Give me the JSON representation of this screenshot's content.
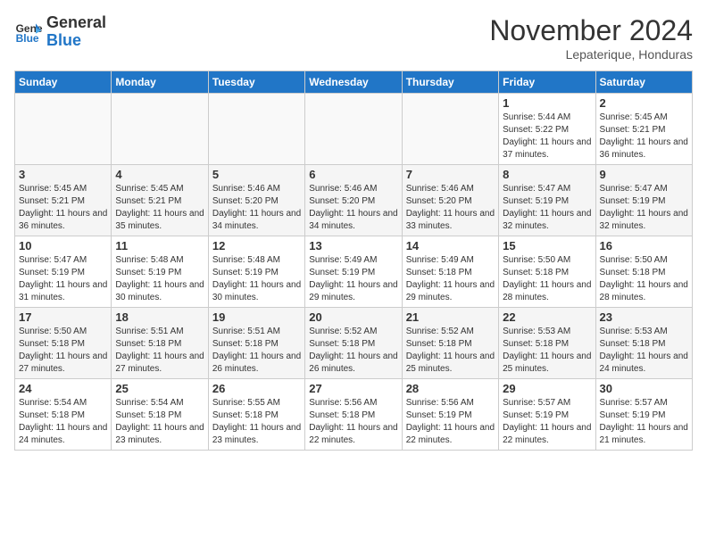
{
  "header": {
    "logo_line1": "General",
    "logo_line2": "Blue",
    "month": "November 2024",
    "location": "Lepaterique, Honduras"
  },
  "weekdays": [
    "Sunday",
    "Monday",
    "Tuesday",
    "Wednesday",
    "Thursday",
    "Friday",
    "Saturday"
  ],
  "weeks": [
    [
      {
        "day": "",
        "info": ""
      },
      {
        "day": "",
        "info": ""
      },
      {
        "day": "",
        "info": ""
      },
      {
        "day": "",
        "info": ""
      },
      {
        "day": "",
        "info": ""
      },
      {
        "day": "1",
        "info": "Sunrise: 5:44 AM\nSunset: 5:22 PM\nDaylight: 11 hours and 37 minutes."
      },
      {
        "day": "2",
        "info": "Sunrise: 5:45 AM\nSunset: 5:21 PM\nDaylight: 11 hours and 36 minutes."
      }
    ],
    [
      {
        "day": "3",
        "info": "Sunrise: 5:45 AM\nSunset: 5:21 PM\nDaylight: 11 hours and 36 minutes."
      },
      {
        "day": "4",
        "info": "Sunrise: 5:45 AM\nSunset: 5:21 PM\nDaylight: 11 hours and 35 minutes."
      },
      {
        "day": "5",
        "info": "Sunrise: 5:46 AM\nSunset: 5:20 PM\nDaylight: 11 hours and 34 minutes."
      },
      {
        "day": "6",
        "info": "Sunrise: 5:46 AM\nSunset: 5:20 PM\nDaylight: 11 hours and 34 minutes."
      },
      {
        "day": "7",
        "info": "Sunrise: 5:46 AM\nSunset: 5:20 PM\nDaylight: 11 hours and 33 minutes."
      },
      {
        "day": "8",
        "info": "Sunrise: 5:47 AM\nSunset: 5:19 PM\nDaylight: 11 hours and 32 minutes."
      },
      {
        "day": "9",
        "info": "Sunrise: 5:47 AM\nSunset: 5:19 PM\nDaylight: 11 hours and 32 minutes."
      }
    ],
    [
      {
        "day": "10",
        "info": "Sunrise: 5:47 AM\nSunset: 5:19 PM\nDaylight: 11 hours and 31 minutes."
      },
      {
        "day": "11",
        "info": "Sunrise: 5:48 AM\nSunset: 5:19 PM\nDaylight: 11 hours and 30 minutes."
      },
      {
        "day": "12",
        "info": "Sunrise: 5:48 AM\nSunset: 5:19 PM\nDaylight: 11 hours and 30 minutes."
      },
      {
        "day": "13",
        "info": "Sunrise: 5:49 AM\nSunset: 5:19 PM\nDaylight: 11 hours and 29 minutes."
      },
      {
        "day": "14",
        "info": "Sunrise: 5:49 AM\nSunset: 5:18 PM\nDaylight: 11 hours and 29 minutes."
      },
      {
        "day": "15",
        "info": "Sunrise: 5:50 AM\nSunset: 5:18 PM\nDaylight: 11 hours and 28 minutes."
      },
      {
        "day": "16",
        "info": "Sunrise: 5:50 AM\nSunset: 5:18 PM\nDaylight: 11 hours and 28 minutes."
      }
    ],
    [
      {
        "day": "17",
        "info": "Sunrise: 5:50 AM\nSunset: 5:18 PM\nDaylight: 11 hours and 27 minutes."
      },
      {
        "day": "18",
        "info": "Sunrise: 5:51 AM\nSunset: 5:18 PM\nDaylight: 11 hours and 27 minutes."
      },
      {
        "day": "19",
        "info": "Sunrise: 5:51 AM\nSunset: 5:18 PM\nDaylight: 11 hours and 26 minutes."
      },
      {
        "day": "20",
        "info": "Sunrise: 5:52 AM\nSunset: 5:18 PM\nDaylight: 11 hours and 26 minutes."
      },
      {
        "day": "21",
        "info": "Sunrise: 5:52 AM\nSunset: 5:18 PM\nDaylight: 11 hours and 25 minutes."
      },
      {
        "day": "22",
        "info": "Sunrise: 5:53 AM\nSunset: 5:18 PM\nDaylight: 11 hours and 25 minutes."
      },
      {
        "day": "23",
        "info": "Sunrise: 5:53 AM\nSunset: 5:18 PM\nDaylight: 11 hours and 24 minutes."
      }
    ],
    [
      {
        "day": "24",
        "info": "Sunrise: 5:54 AM\nSunset: 5:18 PM\nDaylight: 11 hours and 24 minutes."
      },
      {
        "day": "25",
        "info": "Sunrise: 5:54 AM\nSunset: 5:18 PM\nDaylight: 11 hours and 23 minutes."
      },
      {
        "day": "26",
        "info": "Sunrise: 5:55 AM\nSunset: 5:18 PM\nDaylight: 11 hours and 23 minutes."
      },
      {
        "day": "27",
        "info": "Sunrise: 5:56 AM\nSunset: 5:18 PM\nDaylight: 11 hours and 22 minutes."
      },
      {
        "day": "28",
        "info": "Sunrise: 5:56 AM\nSunset: 5:19 PM\nDaylight: 11 hours and 22 minutes."
      },
      {
        "day": "29",
        "info": "Sunrise: 5:57 AM\nSunset: 5:19 PM\nDaylight: 11 hours and 22 minutes."
      },
      {
        "day": "30",
        "info": "Sunrise: 5:57 AM\nSunset: 5:19 PM\nDaylight: 11 hours and 21 minutes."
      }
    ]
  ]
}
